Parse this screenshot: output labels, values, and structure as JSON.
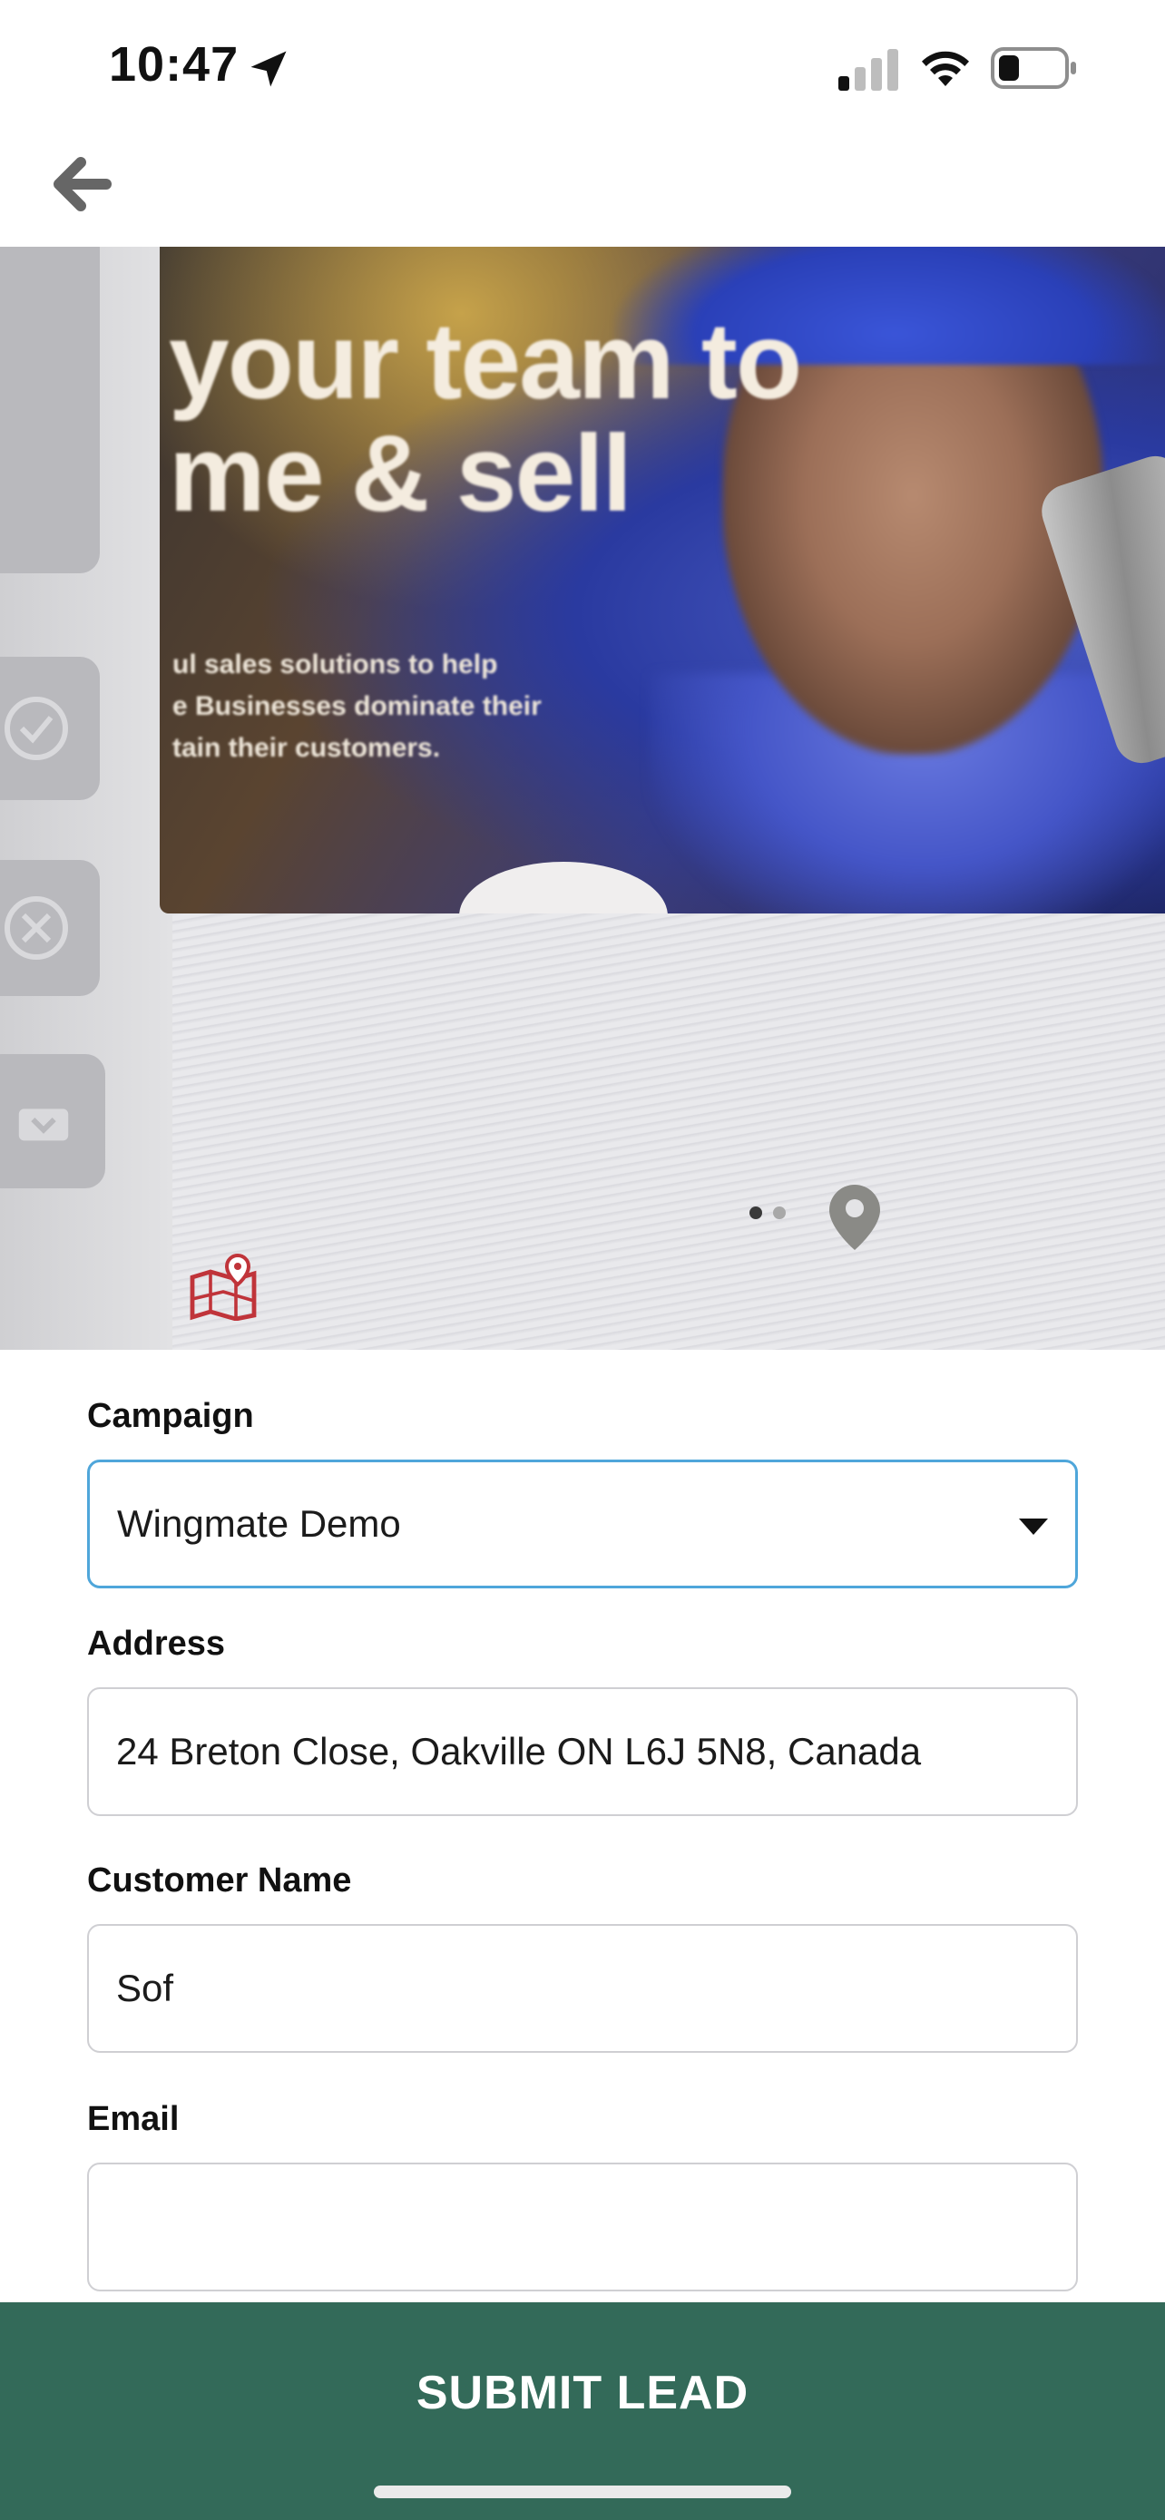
{
  "status_bar": {
    "time": "10:47"
  },
  "photo": {
    "headline_line1": "your team to",
    "headline_line2": "me & sell",
    "sub_line1": "ul sales solutions to help",
    "sub_line2": "e Businesses dominate their",
    "sub_line3": "tain their customers."
  },
  "form": {
    "campaign": {
      "label": "Campaign",
      "value": "Wingmate Demo"
    },
    "address": {
      "label": "Address",
      "value": "24 Breton Close, Oakville ON L6J 5N8, Canada"
    },
    "customer_name": {
      "label": "Customer Name",
      "value": "Sof"
    },
    "email": {
      "label": "Email",
      "value": ""
    }
  },
  "submit": {
    "label": "SUBMIT LEAD"
  },
  "colors": {
    "accent_border": "#4fa6da",
    "submit_bg": "#336a59",
    "map_icon": "#c0343a"
  },
  "icons": {
    "back": "arrow-left-icon",
    "location": "location-arrow-icon",
    "signal": "cellular-signal-icon",
    "wifi": "wifi-icon",
    "battery": "battery-icon",
    "pin": "map-pin-icon",
    "map": "map-location-icon",
    "dropdown": "chevron-down-icon"
  }
}
